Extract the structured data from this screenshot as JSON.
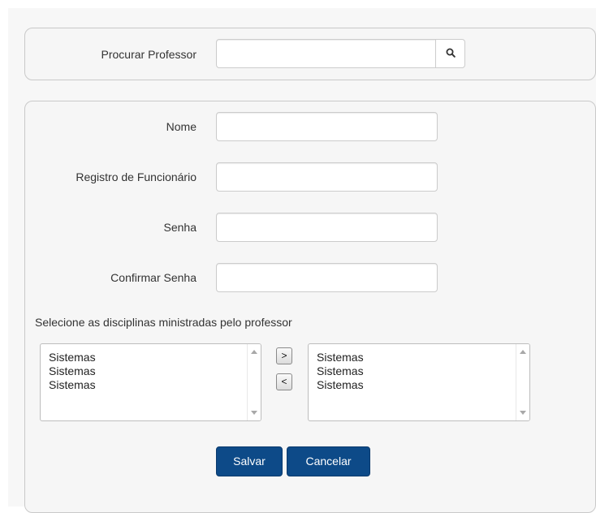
{
  "search": {
    "label": "Procurar Professor",
    "value": "",
    "icon": "search-icon"
  },
  "form": {
    "fields": [
      {
        "label": "Nome",
        "value": ""
      },
      {
        "label": "Registro de Funcionário",
        "value": ""
      },
      {
        "label": "Senha",
        "value": ""
      },
      {
        "label": "Confirmar Senha",
        "value": ""
      }
    ],
    "disciplines_title": "Selecione as disciplinas ministradas pelo professor",
    "available_list": [
      "Sistemas",
      "Sistemas",
      "Sistemas"
    ],
    "selected_list": [
      "Sistemas",
      "Sistemas",
      "Sistemas"
    ],
    "move_right_label": ">",
    "move_left_label": "<",
    "save_label": "Salvar",
    "cancel_label": "Cancelar"
  },
  "colors": {
    "primary_button": "#0d4a88",
    "panel_background": "#f6f6f6",
    "panel_border": "#c9c9c9"
  }
}
